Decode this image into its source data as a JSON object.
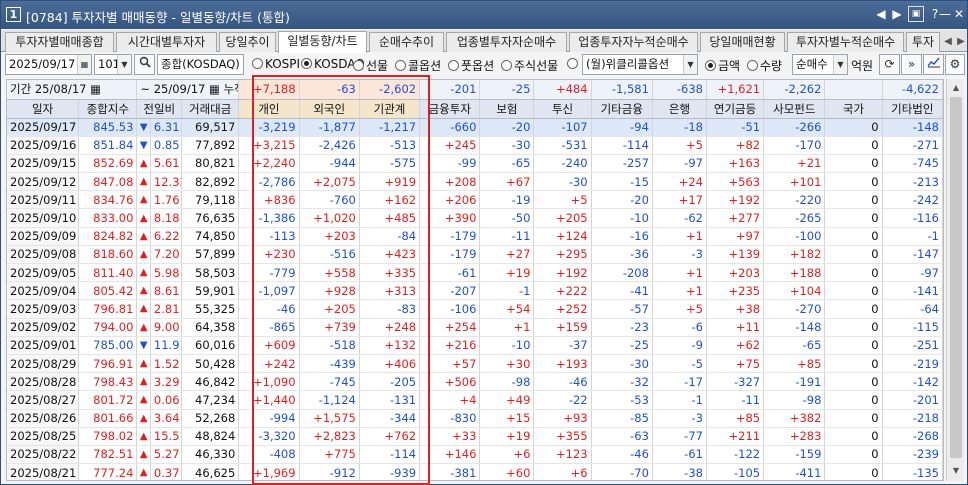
{
  "window": {
    "number": "1",
    "title": "[0784] 투자자별 매매동향 - 일별동향/차트 (통합)",
    "controls": [
      "◀",
      "▶",
      "▣",
      "?",
      "—",
      "✕"
    ]
  },
  "tabs": [
    "투자자별매매종합",
    "시간대별투자자",
    "당일추이",
    "일별동향/차트",
    "순매수추이",
    "업종별투자자순매수",
    "업종투자자누적순매수",
    "당일매매현황",
    "투자자별누적순매수",
    "투자"
  ],
  "active_tab": 3,
  "controls": {
    "date": "2025/09/17",
    "code": "101",
    "market_name": "종합(KOSDAQ)",
    "radios": [
      {
        "label": "KOSPI",
        "on": false
      },
      {
        "label": "KOSDAQ",
        "on": true
      },
      {
        "label": "선물",
        "on": false
      },
      {
        "label": "콜옵션",
        "on": false
      },
      {
        "label": "풋옵션",
        "on": false
      },
      {
        "label": "주식선물",
        "on": false
      },
      {
        "label": "",
        "on": false
      }
    ],
    "weekly_label": "(월)위클리콜옵션",
    "amount_radios": [
      {
        "label": "금액",
        "on": true
      },
      {
        "label": "수량",
        "on": false
      }
    ],
    "mode": "순매수",
    "unit": "억원"
  },
  "summary": {
    "period_label": "기간",
    "from": "25/08/17",
    "to": "25/09/17",
    "cum_label": "누적순매수",
    "values": [
      {
        "v": "+7,188",
        "c": "up"
      },
      {
        "v": "-63",
        "c": "dn"
      },
      {
        "v": "-2,602",
        "c": "dn"
      },
      {
        "v": "-201",
        "c": "dn"
      },
      {
        "v": "-25",
        "c": "dn"
      },
      {
        "v": "+484",
        "c": "up"
      },
      {
        "v": "-1,581",
        "c": "dn"
      },
      {
        "v": "-638",
        "c": "dn"
      },
      {
        "v": "+1,621",
        "c": "up"
      },
      {
        "v": "-2,262",
        "c": "dn"
      },
      {
        "v": "",
        "c": "blk"
      },
      {
        "v": "-4,622",
        "c": "dn"
      }
    ]
  },
  "columns": [
    "일자",
    "종합지수",
    "전일비",
    "거래대금",
    "개인",
    "외국인",
    "기관계",
    "금융투자",
    "보험",
    "투신",
    "기타금융",
    "은행",
    "연기금등",
    "사모펀드",
    "국가",
    "기타법인"
  ],
  "rows": [
    [
      "2025/09/17",
      "845.53",
      "dn",
      "6.31",
      "69,517",
      "-3,219",
      "-1,877",
      "-1,217",
      "-660",
      "-20",
      "-107",
      "-94",
      "-18",
      "-51",
      "-266",
      "0",
      "-148"
    ],
    [
      "2025/09/16",
      "851.84",
      "dn",
      "0.85",
      "77,892",
      "+3,215",
      "-2,426",
      "-513",
      "+245",
      "-30",
      "-531",
      "-114",
      "+5",
      "+82",
      "-170",
      "0",
      "-271"
    ],
    [
      "2025/09/15",
      "852.69",
      "up",
      "5.61",
      "80,821",
      "+2,240",
      "-944",
      "-575",
      "-99",
      "-65",
      "-240",
      "-257",
      "-97",
      "+163",
      "+21",
      "0",
      "-745"
    ],
    [
      "2025/09/12",
      "847.08",
      "up",
      "12.32",
      "82,892",
      "-2,786",
      "+2,075",
      "+919",
      "+208",
      "+67",
      "-30",
      "-15",
      "+24",
      "+563",
      "+101",
      "0",
      "-213"
    ],
    [
      "2025/09/11",
      "834.76",
      "up",
      "1.76",
      "79,118",
      "+836",
      "-760",
      "+162",
      "+206",
      "-19",
      "+5",
      "-20",
      "+17",
      "+192",
      "-220",
      "0",
      "-242"
    ],
    [
      "2025/09/10",
      "833.00",
      "up",
      "8.18",
      "76,635",
      "-1,386",
      "+1,020",
      "+485",
      "+390",
      "-50",
      "+205",
      "-10",
      "-62",
      "+277",
      "-265",
      "0",
      "-116"
    ],
    [
      "2025/09/09",
      "824.82",
      "up",
      "6.22",
      "74,850",
      "-113",
      "+203",
      "-84",
      "-179",
      "-11",
      "+124",
      "-16",
      "+1",
      "+97",
      "-100",
      "0",
      "-1"
    ],
    [
      "2025/09/08",
      "818.60",
      "up",
      "7.20",
      "57,899",
      "+230",
      "-516",
      "+423",
      "-179",
      "+27",
      "+295",
      "-36",
      "-3",
      "+139",
      "+182",
      "0",
      "-147"
    ],
    [
      "2025/09/05",
      "811.40",
      "up",
      "5.98",
      "58,503",
      "-779",
      "+558",
      "+335",
      "-61",
      "+19",
      "+192",
      "-208",
      "+1",
      "+203",
      "+188",
      "0",
      "-97"
    ],
    [
      "2025/09/04",
      "805.42",
      "up",
      "8.61",
      "59,901",
      "-1,097",
      "+928",
      "+313",
      "-207",
      "-1",
      "+222",
      "-41",
      "+1",
      "+235",
      "+104",
      "0",
      "-141"
    ],
    [
      "2025/09/03",
      "796.81",
      "up",
      "2.81",
      "55,325",
      "-46",
      "+205",
      "-83",
      "-106",
      "+54",
      "+252",
      "-57",
      "+5",
      "+38",
      "-270",
      "0",
      "-64"
    ],
    [
      "2025/09/02",
      "794.00",
      "up",
      "9.00",
      "64,358",
      "-865",
      "+739",
      "+248",
      "+254",
      "+1",
      "+159",
      "-23",
      "-6",
      "+11",
      "-148",
      "0",
      "-115"
    ],
    [
      "2025/09/01",
      "785.00",
      "dn",
      "11.91",
      "60,016",
      "+609",
      "-518",
      "+132",
      "+216",
      "-10",
      "-37",
      "-25",
      "-9",
      "+62",
      "-65",
      "0",
      "-251"
    ],
    [
      "2025/08/29",
      "796.91",
      "up",
      "1.52",
      "50,428",
      "+242",
      "-439",
      "+406",
      "+57",
      "+30",
      "+193",
      "-30",
      "-5",
      "+75",
      "+85",
      "0",
      "-219"
    ],
    [
      "2025/08/28",
      "798.43",
      "up",
      "3.29",
      "46,842",
      "+1,090",
      "-745",
      "-205",
      "+506",
      "-98",
      "-46",
      "-32",
      "-17",
      "-327",
      "-191",
      "0",
      "-142"
    ],
    [
      "2025/08/27",
      "801.72",
      "up",
      "0.06",
      "47,234",
      "+1,440",
      "-1,124",
      "-131",
      "+4",
      "+49",
      "-22",
      "-53",
      "-1",
      "-11",
      "-98",
      "0",
      "-201"
    ],
    [
      "2025/08/26",
      "801.66",
      "up",
      "3.64",
      "52,268",
      "-994",
      "+1,575",
      "-344",
      "-830",
      "+15",
      "+93",
      "-85",
      "-3",
      "+85",
      "+382",
      "0",
      "-218"
    ],
    [
      "2025/08/25",
      "798.02",
      "up",
      "15.51",
      "48,824",
      "-3,320",
      "+2,823",
      "+762",
      "+33",
      "+19",
      "+355",
      "-63",
      "-77",
      "+211",
      "+283",
      "0",
      "-268"
    ],
    [
      "2025/08/22",
      "782.51",
      "up",
      "5.27",
      "46,330",
      "-408",
      "+775",
      "-114",
      "+146",
      "+6",
      "+123",
      "-46",
      "-61",
      "-122",
      "-159",
      "0",
      "-239"
    ],
    [
      "2025/08/21",
      "777.24",
      "up",
      "0.37",
      "46,625",
      "+1,969",
      "-912",
      "-939",
      "-381",
      "+60",
      "+6",
      "-70",
      "-38",
      "-105",
      "-411",
      "0",
      "-135"
    ]
  ],
  "colors": {
    "up": "#e02020",
    "down": "#2050d0",
    "header": "#dfe6f1",
    "investor_header": "#f3e6cc",
    "highlight_box": "#e02020"
  }
}
